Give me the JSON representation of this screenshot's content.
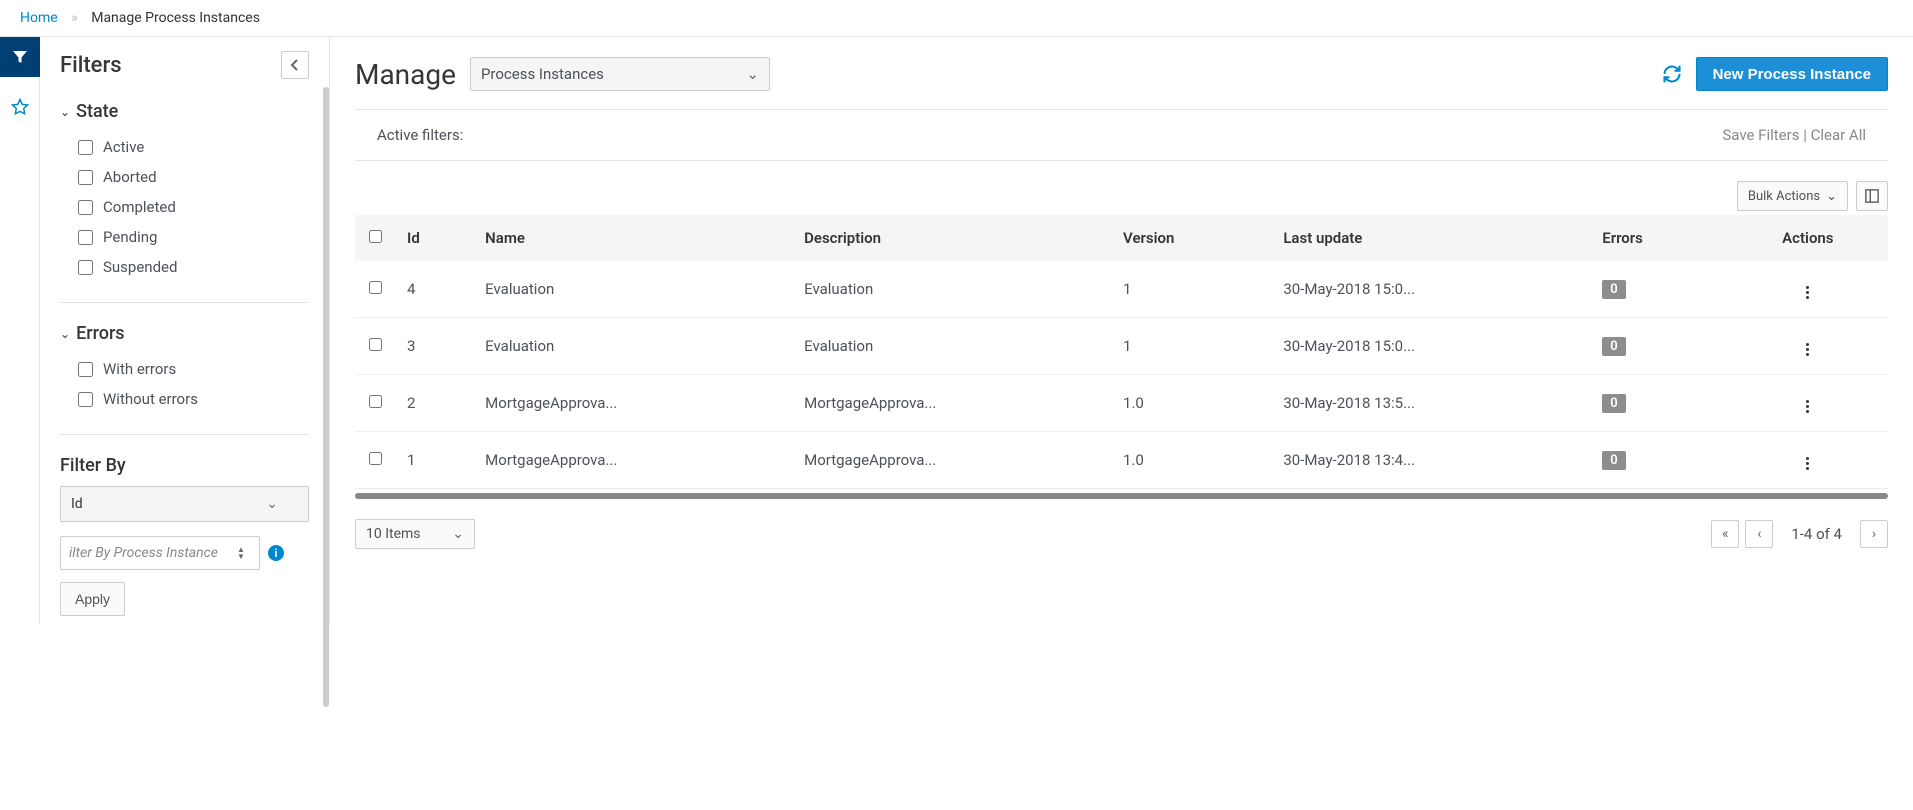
{
  "breadcrumb": {
    "home": "Home",
    "current": "Manage Process Instances"
  },
  "sidebar": {
    "title": "Filters",
    "groups": {
      "state": {
        "title": "State",
        "items": [
          "Active",
          "Aborted",
          "Completed",
          "Pending",
          "Suspended"
        ]
      },
      "errors": {
        "title": "Errors",
        "items": [
          "With errors",
          "Without errors"
        ]
      }
    },
    "filter_by": {
      "title": "Filter By",
      "selected": "Id",
      "input_placeholder": "ilter By Process Instance",
      "apply": "Apply"
    }
  },
  "header": {
    "title": "Manage",
    "type_selected": "Process Instances",
    "new_btn": "New Process Instance"
  },
  "active_filters": {
    "label": "Active filters:",
    "save": "Save Filters",
    "clear": "Clear All"
  },
  "bulk_actions_label": "Bulk Actions",
  "columns": {
    "id": "Id",
    "name": "Name",
    "description": "Description",
    "version": "Version",
    "last_update": "Last update",
    "errors": "Errors",
    "actions": "Actions"
  },
  "rows": [
    {
      "id": "4",
      "name": "Evaluation",
      "desc": "Evaluation",
      "version": "1",
      "updated": "30-May-2018 15:0...",
      "errors": "0"
    },
    {
      "id": "3",
      "name": "Evaluation",
      "desc": "Evaluation",
      "version": "1",
      "updated": "30-May-2018 15:0...",
      "errors": "0"
    },
    {
      "id": "2",
      "name": "MortgageApprova...",
      "desc": "MortgageApprova...",
      "version": "1.0",
      "updated": "30-May-2018 13:5...",
      "errors": "0"
    },
    {
      "id": "1",
      "name": "MortgageApprova...",
      "desc": "MortgageApprova...",
      "version": "1.0",
      "updated": "30-May-2018 13:4...",
      "errors": "0"
    }
  ],
  "pagination": {
    "page_size": "10 Items",
    "range": "1-4 of 4"
  }
}
